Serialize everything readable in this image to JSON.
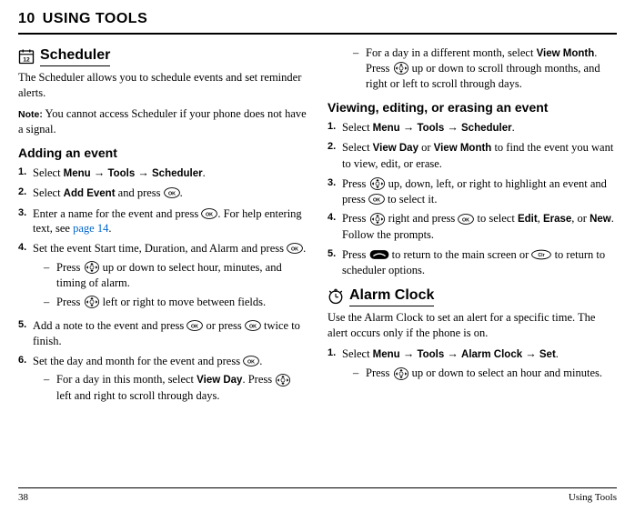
{
  "chapter": {
    "num": "10",
    "title": "USING TOOLS"
  },
  "footer": {
    "page": "38",
    "section": "Using Tools"
  },
  "col1": {
    "scheduler_title": "Scheduler",
    "scheduler_body": "The Scheduler allows you to schedule events and set reminder alerts.",
    "note_label": "Note:",
    "note_body": "You cannot access Scheduler if your phone does not have a signal.",
    "adding_event": "Adding an event",
    "steps": [
      {
        "num": "1.",
        "pre": "Select ",
        "b1": "Menu",
        "a1": " → ",
        "b2": "Tools",
        "a2": " → ",
        "b3": "Scheduler",
        "post": "."
      },
      {
        "num": "2.",
        "pre": "Select ",
        "b1": "Add Event",
        "mid": " and press ",
        "icon": "ok",
        "post": "."
      },
      {
        "num": "3.",
        "pre": "Enter a name for the event and press ",
        "icon": "ok",
        "mid": ". For help entering text, see ",
        "link": "page 14",
        "post": "."
      },
      {
        "num": "4.",
        "pre": "Set the event Start time, Duration, and Alarm and press ",
        "icon": "ok",
        "post": ".",
        "subs": [
          {
            "pre": "Press ",
            "icon": "nav",
            "post": " up or down to select hour, minutes, and timing of alarm."
          },
          {
            "pre": "Press ",
            "icon": "nav",
            "post": " left or right to move between fields."
          }
        ]
      },
      {
        "num": "5.",
        "pre": "Add a note to the event and press ",
        "icon": "ok",
        "mid": " or press ",
        "icon2": "ok",
        "post": " twice to finish."
      },
      {
        "num": "6.",
        "pre": "Set the day and month for the event and press ",
        "icon": "ok",
        "post": ".",
        "subs": [
          {
            "pre": "For a day in this month, select ",
            "b1": "View Day",
            "mid": ". Press ",
            "icon": "nav",
            "post": " left and right to scroll through days."
          }
        ]
      }
    ]
  },
  "col2": {
    "cont_sub": {
      "pre": "For a day in a different month, select ",
      "b1": "View Month",
      "mid": ". Press ",
      "icon": "nav",
      "post": " up or down to scroll through months, and right or left to scroll through days."
    },
    "viewing_title": "Viewing, editing, or erasing an event",
    "vsteps": [
      {
        "num": "1.",
        "pre": "Select ",
        "b1": "Menu",
        "a1": " → ",
        "b2": "Tools",
        "a2": " → ",
        "b3": "Scheduler",
        "post": "."
      },
      {
        "num": "2.",
        "pre": "Select ",
        "b1": "View Day",
        "mid": " or ",
        "b2": "View Month",
        "post": " to find the event you want to view, edit, or erase."
      },
      {
        "num": "3.",
        "pre": "Press ",
        "icon": "nav",
        "mid": " up, down, left, or right to highlight an event and press ",
        "icon2": "ok",
        "post": " to select it."
      },
      {
        "num": "4.",
        "pre": "Press ",
        "icon": "nav",
        "mid": " right and press ",
        "icon2": "ok",
        "mid2": " to select ",
        "b1": "Edit",
        "a1": ", ",
        "b2": "Erase",
        "a2": ", or ",
        "b3": "New",
        "post": ". Follow the prompts."
      },
      {
        "num": "5.",
        "pre": "Press ",
        "icon": "end",
        "mid": " to return to the main screen or ",
        "icon2": "clr",
        "post": " to return to scheduler options."
      }
    ],
    "alarm_title": "Alarm Clock",
    "alarm_body": "Use the Alarm Clock to set an alert for a specific time. The alert occurs only if the phone is on.",
    "asteps": [
      {
        "num": "1.",
        "pre": "Select ",
        "b1": "Menu",
        "a1": " → ",
        "b2": "Tools",
        "a2": " → ",
        "b3": "Alarm Clock",
        "a3": " → ",
        "b4": "Set",
        "post": ".",
        "subs": [
          {
            "pre": "Press ",
            "icon": "nav",
            "post": " up or down to select an hour and minutes."
          }
        ]
      }
    ]
  }
}
